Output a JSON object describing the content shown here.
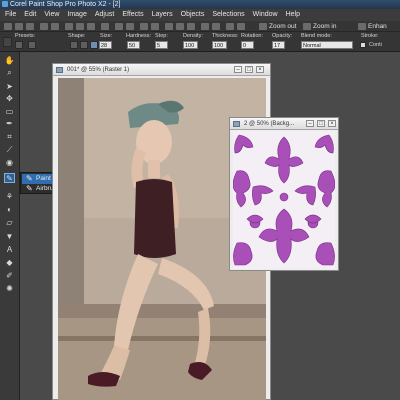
{
  "app": {
    "title": "Corel Paint Shop Pro Photo X2 - [2]",
    "menu": [
      "File",
      "Edit",
      "View",
      "Image",
      "Adjust",
      "Effects",
      "Layers",
      "Objects",
      "Selections",
      "Window",
      "Help"
    ]
  },
  "standard_toolbar": {
    "zoom_out_label": "Zoom out",
    "zoom_in_label": "Zoom in",
    "enhance_label": "Enhan"
  },
  "tool_options": {
    "presets_label": "Presets:",
    "shape_label": "Shape:",
    "size_label": "Size:",
    "size_value": "28",
    "hardness_label": "Hardness:",
    "hardness_value": "50",
    "step_label": "Step:",
    "step_value": "5",
    "density_label": "Density:",
    "density_value": "100",
    "thickness_label": "Thickness:",
    "thickness_value": "100",
    "rotation_label": "Rotation:",
    "rotation_value": "0",
    "opacity_label": "Opacity:",
    "opacity_value": "17",
    "blend_mode_label": "Blend mode:",
    "blend_mode_value": "Normal",
    "stroke_label": "Stroke:",
    "continuous_label": "Conti"
  },
  "tool_flyout": {
    "items": [
      {
        "label": "Paint Brush",
        "shortcut": "B",
        "icon": "paint-brush-icon",
        "selected": true
      },
      {
        "label": "Airbrush",
        "shortcut": "",
        "icon": "airbrush-icon",
        "selected": false
      }
    ]
  },
  "documents": [
    {
      "title": "001* @ 55% (Raster 1)"
    },
    {
      "title": "2 @ 50% (Backg..."
    }
  ],
  "colors": {
    "accent": "#2f6fb1",
    "dark_ui": "#353535",
    "workspace": "#4a4a4a",
    "pattern_purple": "#a84fb8"
  }
}
